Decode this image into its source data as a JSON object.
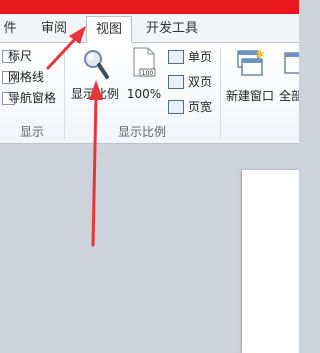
{
  "tabs": {
    "file_partial": "件",
    "review": "审阅",
    "view": "视图",
    "developer": "开发工具"
  },
  "show_group": {
    "ruler": "标尺",
    "gridlines": "网格线",
    "nav_pane": "导航窗格",
    "label": "显示"
  },
  "zoom_group": {
    "zoom": "显示比例",
    "percent": "100%",
    "one_page": "单页",
    "two_pages": "双页",
    "page_width": "页宽",
    "label": "显示比例"
  },
  "window_group": {
    "new_window": "新建窗口",
    "arrange_partial": "全部"
  },
  "colors": {
    "title_bar": "#e8181c",
    "arrow": "#e8353a"
  }
}
